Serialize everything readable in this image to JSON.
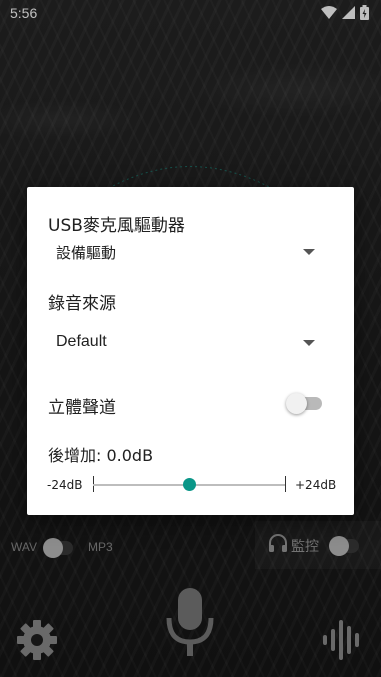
{
  "status_bar": {
    "time": "5:56"
  },
  "dialog": {
    "usb_driver_label": "USB麥克風驅動器",
    "usb_driver_value": "設備驅動",
    "source_label": "錄音來源",
    "source_value": "Default",
    "stereo_label": "立體聲道",
    "stereo_enabled": false,
    "gain_label": "後增加: 0.0dB",
    "gain_min": "-24dB",
    "gain_max": "+24dB",
    "gain_value_db": 0.0,
    "gain_range_db": [
      -24,
      24
    ]
  },
  "format": {
    "wav_label": "WAV",
    "mp3_label": "MP3"
  },
  "monitor": {
    "label": "監控"
  },
  "colors": {
    "accent": "#0a9688"
  },
  "icons": [
    "wifi-icon",
    "signal-icon",
    "battery-icon",
    "headphones-icon",
    "settings-gear-icon",
    "microphone-icon",
    "waveform-icon"
  ]
}
